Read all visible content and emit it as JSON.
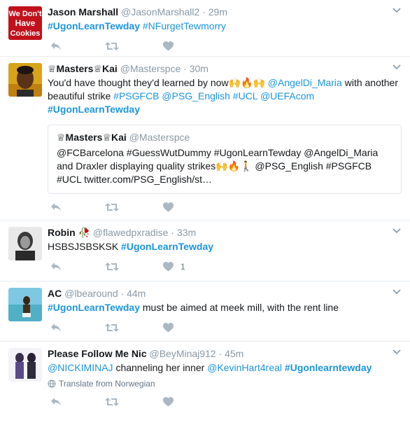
{
  "tweets": [
    {
      "name": "Jason Marshall",
      "handle": "@JasonMarshall2",
      "time": "29m",
      "avatar_lines": [
        "We Don't",
        "Have",
        "Cookies"
      ],
      "text_parts": [
        "#UgonLearnTewday",
        " ",
        "#NFurgetTewmorry"
      ],
      "likes": ""
    },
    {
      "name": "♕Masters♕Kai",
      "handle": "@Masterspce",
      "time": "30m",
      "text_parts": [
        "You'd have thought they'd learned by now🙌🔥🙌 ",
        "@AngelDi_Maria",
        " with another beautiful strike ",
        "#PSGFCB",
        " ",
        "@PSG_English",
        " ",
        "#UCL",
        " ",
        "@UEFAcom",
        "#UgonLearnTewday"
      ],
      "quote": {
        "name": "♕Masters♕Kai",
        "handle": "@Masterspce",
        "text": "@FCBarcelona  #GuessWutDummy #UgonLearnTewday @AngelDi_Maria and Draxler displaying quality strikes🙌🔥🚶  @PSG_English #PSGFCB #UCL twitter.com/PSG_English/st…"
      },
      "likes": ""
    },
    {
      "name": "Robin",
      "name_emoji": "🥀",
      "handle": "@flawedpxradise",
      "time": "33m",
      "text_parts": [
        "HSBSJSBSKSK ",
        "#UgonLearnTewday"
      ],
      "likes": "1"
    },
    {
      "name": "AC",
      "handle": "@lbearound",
      "time": "44m",
      "text_parts": [
        "#UgonLearnTewday",
        " must be aimed at meek mill, with the rent line"
      ],
      "likes": ""
    },
    {
      "name": "Please Follow Me Nic",
      "handle": "@BeyMinaj912",
      "time": "45m",
      "text_parts": [
        "@NICKIMINAJ",
        " channeling her inner ",
        "@KevinHart4real",
        " ",
        "#Ugonlearntewday"
      ],
      "translate": "Translate from Norwegian",
      "likes": ""
    }
  ],
  "icons": {
    "reply": "reply-icon",
    "retweet": "retweet-icon",
    "like": "heart-icon",
    "caret": "chevron-down-icon",
    "translate": "globe-icon"
  },
  "colors": {
    "link": "#1b95e0",
    "secondary": "#8899a6",
    "icon": "#aab8c2"
  }
}
